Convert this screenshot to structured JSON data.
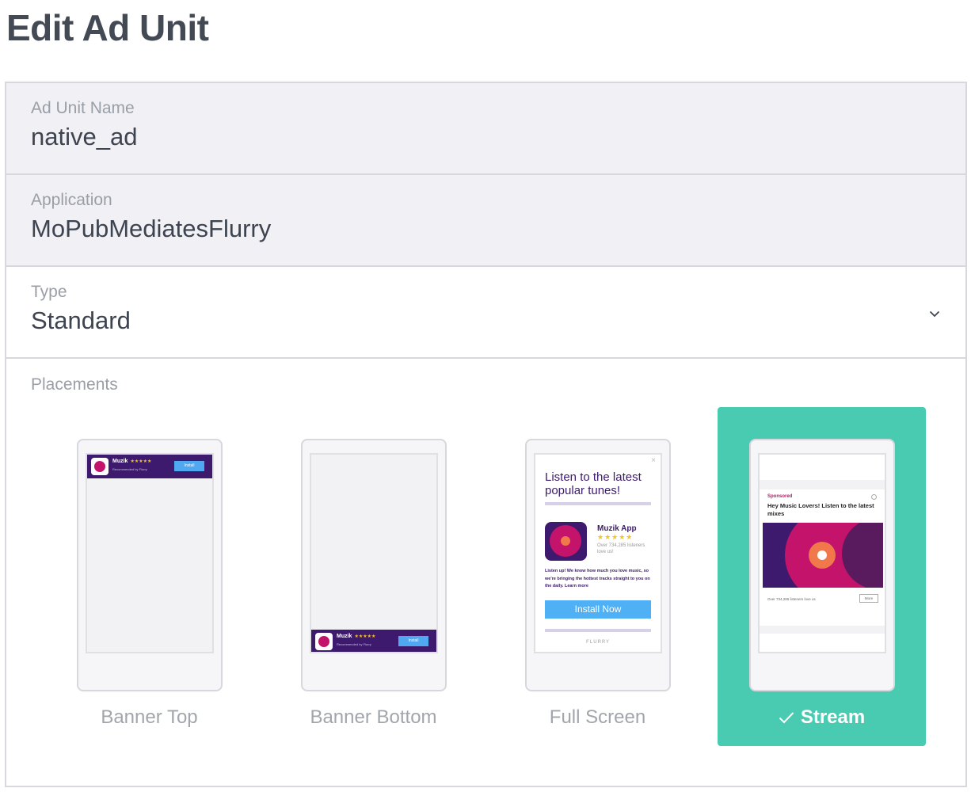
{
  "page": {
    "title": "Edit Ad Unit"
  },
  "fields": {
    "ad_unit_name": {
      "label": "Ad Unit Name",
      "value": "native_ad"
    },
    "application": {
      "label": "Application",
      "value": "MoPubMediatesFlurry"
    },
    "type": {
      "label": "Type",
      "value": "Standard"
    }
  },
  "placements": {
    "label": "Placements",
    "selected": "Stream",
    "items": [
      {
        "label": "Banner Top"
      },
      {
        "label": "Banner Bottom"
      },
      {
        "label": "Full Screen"
      },
      {
        "label": "Stream"
      }
    ]
  },
  "preview": {
    "banner": {
      "name": "Muzik",
      "stars": "★★★★★",
      "sub": "Recommended by Flurry",
      "button": "Install"
    },
    "full_screen": {
      "headline": "Listen to the latest popular tunes!",
      "app_name": "Muzik App",
      "stars": "★★★★★",
      "count": "Over 734,285 listeners love us!",
      "body": "Listen up! We know how much you love music, so we're bringing the hottest tracks straight to you on the daily. Learn more",
      "button": "Install Now",
      "brand": "FLURRY"
    },
    "stream": {
      "sponsored": "Sponsored",
      "title": "Hey Music Lovers! Listen to the latest mixes",
      "count": "Over 734,285 listeners love us",
      "more": "More"
    }
  },
  "colors": {
    "accent": "#48cbb1",
    "banner": "#3d1a6e",
    "brand_pink": "#c4136a",
    "install_blue": "#4fb0f5"
  }
}
